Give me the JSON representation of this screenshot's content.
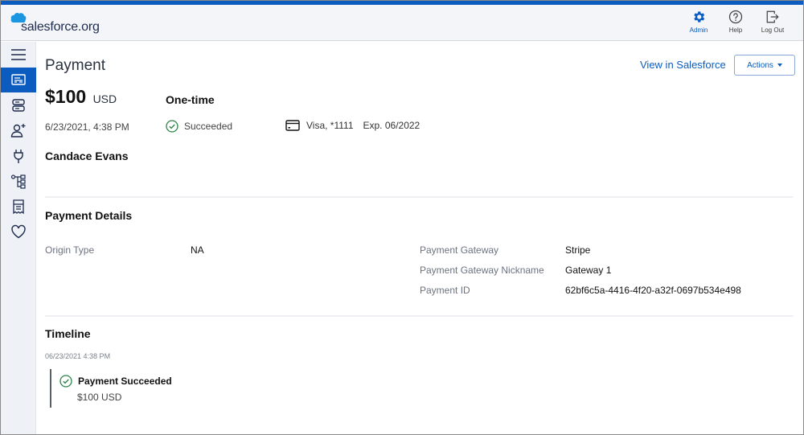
{
  "header": {
    "logo_text": "salesforce.org",
    "actions": [
      {
        "icon": "gear-icon",
        "label": "Admin"
      },
      {
        "icon": "help-icon",
        "label": "Help"
      },
      {
        "icon": "logout-icon",
        "label": "Log Out"
      }
    ]
  },
  "colors": {
    "brand": "#0b5cbe",
    "success": "#2e844a",
    "logo_cloud": "#1b96e0"
  },
  "sidebar": {
    "items": [
      {
        "icon": "menu-icon",
        "active": false
      },
      {
        "icon": "payment-card-icon",
        "active": true
      },
      {
        "icon": "server-icon",
        "active": false
      },
      {
        "icon": "add-user-icon",
        "active": false
      },
      {
        "icon": "plug-icon",
        "active": false
      },
      {
        "icon": "hierarchy-icon",
        "active": false
      },
      {
        "icon": "receipt-icon",
        "active": false
      },
      {
        "icon": "heart-icon",
        "active": false
      }
    ]
  },
  "page": {
    "title": "Payment",
    "view_link": "View in Salesforce",
    "actions_label": "Actions",
    "amount": "$100",
    "currency": "USD",
    "frequency": "One-time",
    "date": "6/23/2021, 4:38 PM",
    "status": "Succeeded",
    "card": "Visa, *1111",
    "expiry": "Exp. 06/2022",
    "donor": "Candace Evans"
  },
  "details": {
    "title": "Payment Details",
    "left": [
      {
        "label": "Origin Type",
        "value": "NA"
      }
    ],
    "right": [
      {
        "label": "Payment Gateway",
        "value": "Stripe"
      },
      {
        "label": "Payment Gateway Nickname",
        "value": "Gateway 1"
      },
      {
        "label": "Payment ID",
        "value": "62bf6c5a-4416-4f20-a32f-0697b534e498"
      }
    ]
  },
  "timeline": {
    "title": "Timeline",
    "date": "06/23/2021 4:38 PM",
    "event": "Payment Succeeded",
    "amount": "$100 USD"
  }
}
